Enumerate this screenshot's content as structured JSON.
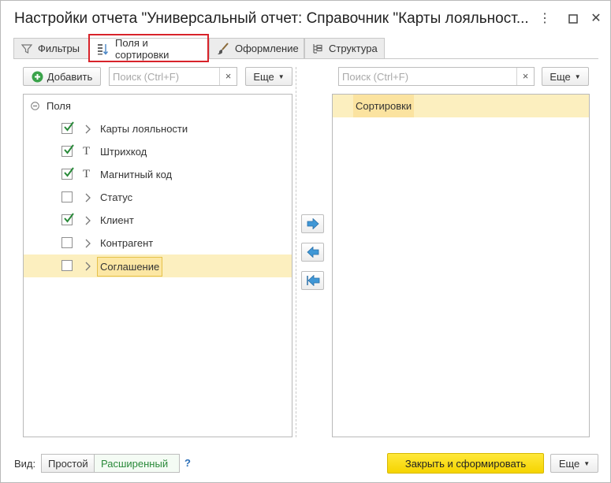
{
  "window": {
    "title": "Настройки отчета \"Универсальный отчет: Справочник \"Карты лояльност...",
    "more_icon": "more-vertical-icon",
    "maximize_icon": "maximize-icon",
    "close_icon": "close-icon"
  },
  "tabs": [
    {
      "label": "Фильтры",
      "icon": "filter-icon"
    },
    {
      "label": "Поля и сортировки",
      "icon": "fields-sort-icon",
      "active": true
    },
    {
      "label": "Оформление",
      "icon": "brush-icon"
    },
    {
      "label": "Структура",
      "icon": "structure-icon"
    }
  ],
  "left_toolbar": {
    "add_label": "Добавить",
    "search_placeholder": "Поиск (Ctrl+F)",
    "clear": "×",
    "more_label": "Еще"
  },
  "right_toolbar": {
    "search_placeholder": "Поиск (Ctrl+F)",
    "clear": "×",
    "more_label": "Еще"
  },
  "fields_tree": {
    "root_label": "Поля",
    "items": [
      {
        "label": "Карты лояльности",
        "checked": true,
        "kind": "group"
      },
      {
        "label": "Штрихкод",
        "checked": true,
        "kind": "text"
      },
      {
        "label": "Магнитный код",
        "checked": true,
        "kind": "text"
      },
      {
        "label": "Статус",
        "checked": false,
        "kind": "group"
      },
      {
        "label": "Клиент",
        "checked": true,
        "kind": "group"
      },
      {
        "label": "Контрагент",
        "checked": false,
        "kind": "group"
      },
      {
        "label": "Соглашение",
        "checked": false,
        "kind": "group",
        "selected": true
      }
    ]
  },
  "sort_panel": {
    "root_label": "Сортировки"
  },
  "footer": {
    "view_label": "Вид:",
    "simple_label": "Простой",
    "extended_label": "Расширенный",
    "help": "?",
    "primary_label": "Закрыть и сформировать",
    "more_label": "Еще"
  },
  "colors": {
    "accent_yellow": "#f5d400",
    "selection": "#fcefbf",
    "highlight_red": "#d8232a",
    "check_green": "#2a8a3a",
    "arrow_blue": "#3f97d6"
  }
}
